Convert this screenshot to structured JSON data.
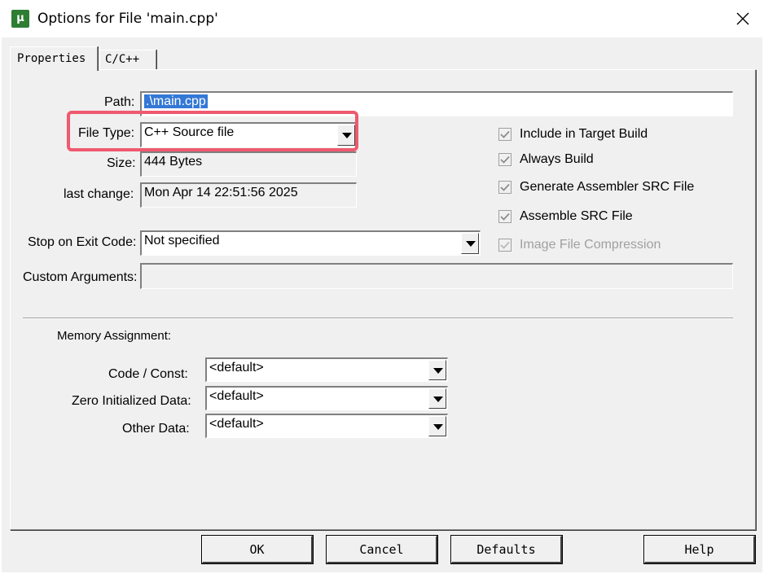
{
  "window": {
    "title": "Options for File 'main.cpp'",
    "icon": "keil-uvision-icon"
  },
  "tabs": [
    {
      "label": "Properties",
      "active": true
    },
    {
      "label": "C/C++",
      "active": false
    }
  ],
  "properties": {
    "path_label": "Path:",
    "path_value": ".\\main.cpp",
    "file_type_label": "File Type:",
    "file_type_value": "C++ Source file",
    "size_label": "Size:",
    "size_value": "444 Bytes",
    "last_change_label": "last change:",
    "last_change_value": "Mon Apr 14 22:51:56 2025",
    "stop_label": "Stop on Exit Code:",
    "stop_value": "Not specified",
    "custom_args_label": "Custom Arguments:",
    "custom_args_value": ""
  },
  "checkboxes": [
    {
      "label": "Include in Target Build",
      "checked": true,
      "enabled": true
    },
    {
      "label": "Always Build",
      "checked": true,
      "enabled": true
    },
    {
      "label": "Generate Assembler SRC File",
      "checked": true,
      "enabled": true
    },
    {
      "label": "Assemble SRC File",
      "checked": true,
      "enabled": true
    },
    {
      "label": "Image File Compression",
      "checked": true,
      "enabled": false
    }
  ],
  "memory": {
    "heading": "Memory Assignment:",
    "code_label": "Code / Const:",
    "code_value": "<default>",
    "zero_label": "Zero Initialized Data:",
    "zero_value": "<default>",
    "other_label": "Other Data:",
    "other_value": "<default>"
  },
  "buttons": {
    "ok": "OK",
    "cancel": "Cancel",
    "defaults": "Defaults",
    "help": "Help"
  },
  "colors": {
    "highlight": "#ee5a6f",
    "selection": "#3478d6"
  }
}
